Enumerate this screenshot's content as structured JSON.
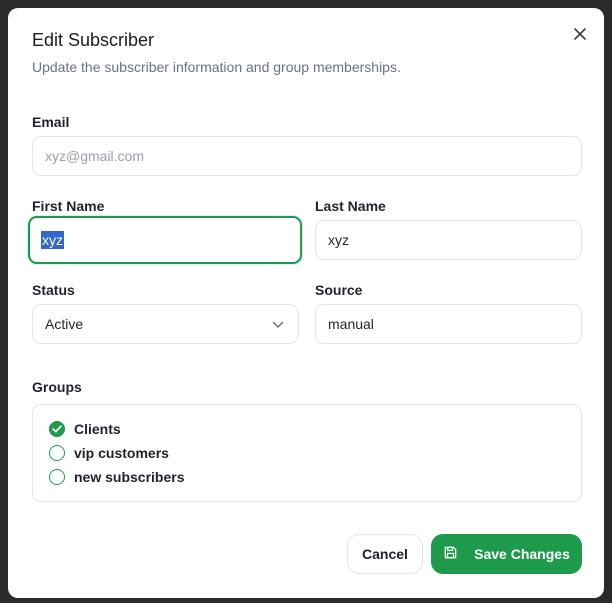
{
  "dialog": {
    "title": "Edit Subscriber",
    "subtitle": "Update the subscriber information and group memberships."
  },
  "form": {
    "email": {
      "label": "Email",
      "value": "xyz@gmail.com"
    },
    "first_name": {
      "label": "First Name",
      "value": "xyz"
    },
    "last_name": {
      "label": "Last Name",
      "value": "xyz"
    },
    "status": {
      "label": "Status",
      "value": "Active"
    },
    "source": {
      "label": "Source",
      "value": "manual"
    }
  },
  "groups": {
    "label": "Groups",
    "items": [
      {
        "label": "Clients",
        "checked": true
      },
      {
        "label": "vip customers",
        "checked": false
      },
      {
        "label": "new subscribers",
        "checked": false
      }
    ]
  },
  "actions": {
    "cancel_label": "Cancel",
    "save_label": "Save Changes"
  },
  "colors": {
    "accent": "#1e9a4d",
    "selection": "#3466c7",
    "border": "#e3e5e8"
  },
  "icons": {
    "close": "close-icon",
    "dropdown": "chevron-down-icon",
    "save": "save-icon",
    "checked": "check-circle-icon"
  }
}
